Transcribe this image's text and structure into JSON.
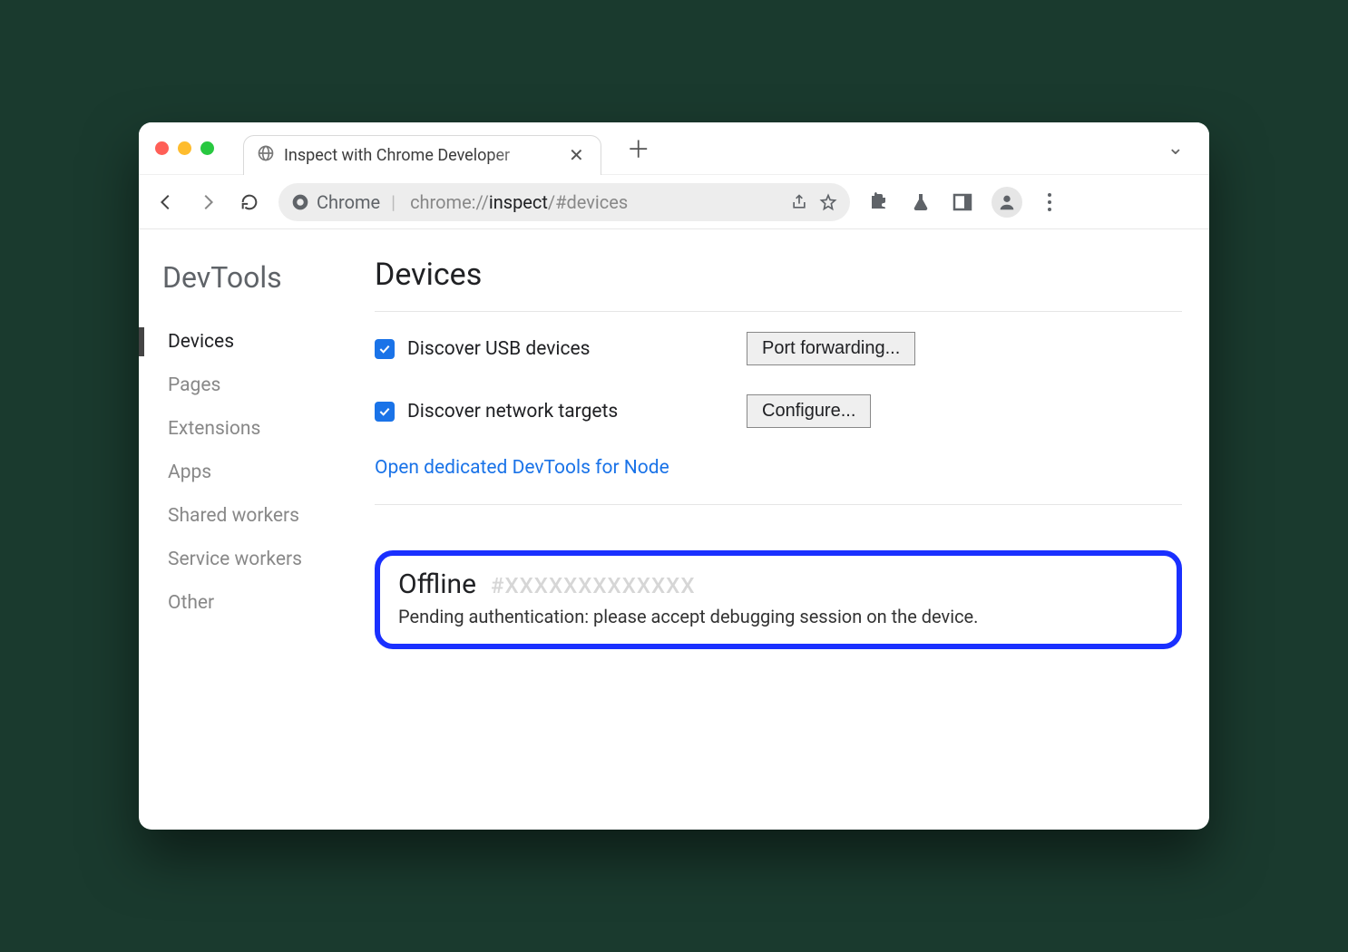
{
  "tab": {
    "title": "Inspect with Chrome Developer"
  },
  "addressbar": {
    "chip_label": "Chrome",
    "url_path": "chrome://",
    "url_bold": "inspect",
    "url_hash": "/#devices"
  },
  "sidebar": {
    "title": "DevTools",
    "items": [
      {
        "label": "Devices",
        "active": true
      },
      {
        "label": "Pages",
        "active": false
      },
      {
        "label": "Extensions",
        "active": false
      },
      {
        "label": "Apps",
        "active": false
      },
      {
        "label": "Shared workers",
        "active": false
      },
      {
        "label": "Service workers",
        "active": false
      },
      {
        "label": "Other",
        "active": false
      }
    ]
  },
  "main": {
    "title": "Devices",
    "discover_usb_label": "Discover USB devices",
    "port_forwarding_btn": "Port forwarding...",
    "discover_network_label": "Discover network targets",
    "configure_btn": "Configure...",
    "node_link": "Open dedicated DevTools for Node",
    "offline_label": "Offline",
    "offline_hash": "#XXXXXXXXXXXXX",
    "pending_text": "Pending authentication: please accept debugging session on the device."
  }
}
